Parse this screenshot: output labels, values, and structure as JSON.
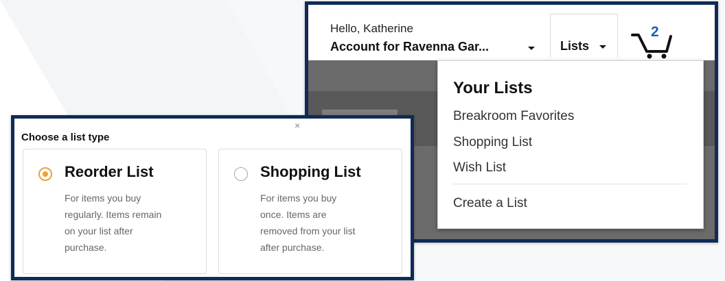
{
  "header": {
    "greeting": "Hello, Katherine",
    "account_label": "Account for Ravenna Gar...",
    "lists_label": "Lists",
    "cart_count": "2"
  },
  "lists_menu": {
    "title": "Your Lists",
    "items": [
      {
        "label": "Breakroom Favorites"
      },
      {
        "label": "Shopping List"
      },
      {
        "label": "Wish List"
      }
    ],
    "create_label": "Create a List"
  },
  "list_type": {
    "heading": "Choose a list type",
    "close_mark": "×",
    "options": [
      {
        "title": "Reorder List",
        "desc_lines": [
          "For items you buy",
          "regularly. Items remain",
          "on your list after",
          "purchase."
        ],
        "selected": true
      },
      {
        "title": "Shopping List",
        "desc_lines": [
          "For items you buy",
          "once. Items are",
          "removed from your list",
          "after purchase."
        ],
        "selected": false
      }
    ]
  },
  "colors": {
    "frame": "#0f2b57",
    "radio_accent": "#e9a23b",
    "cart_count": "#1f5fb5",
    "overlay_gray": "#6b6b6b"
  },
  "icons": {
    "cart": "shopping-cart-icon",
    "caret": "caret-down-icon"
  }
}
